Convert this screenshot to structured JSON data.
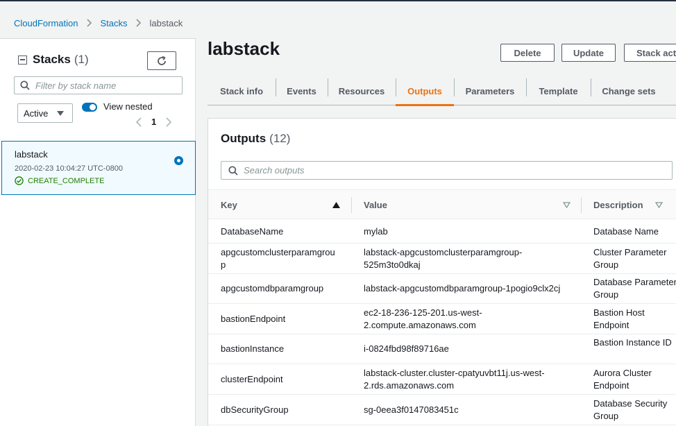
{
  "breadcrumb": {
    "items": [
      "CloudFormation",
      "Stacks"
    ],
    "current": "labstack"
  },
  "sidebar": {
    "title": "Stacks",
    "count": "(1)",
    "filter_placeholder": "Filter by stack name",
    "status_filter": "Active",
    "view_nested_label": "View nested",
    "view_nested_enabled": true,
    "page": "1",
    "stacks": [
      {
        "name": "labstack",
        "date": "2020-02-23 10:04:27 UTC-0800",
        "status": "CREATE_COMPLETE",
        "selected": true
      }
    ]
  },
  "main": {
    "title": "labstack",
    "buttons": {
      "delete": "Delete",
      "update": "Update",
      "stack_actions": "Stack actions"
    },
    "tabs": [
      {
        "label": "Stack info"
      },
      {
        "label": "Events"
      },
      {
        "label": "Resources"
      },
      {
        "label": "Outputs",
        "active": true
      },
      {
        "label": "Parameters"
      },
      {
        "label": "Template"
      },
      {
        "label": "Change sets"
      }
    ]
  },
  "outputs": {
    "title": "Outputs",
    "count": "(12)",
    "search_placeholder": "Search outputs",
    "columns": {
      "key": "Key",
      "value": "Value",
      "description": "Description"
    },
    "rows": [
      {
        "key": "DatabaseName",
        "value": "mylab",
        "description": "Database Name"
      },
      {
        "key": "apgcustomclusterparamgrou p",
        "value": "labstack-apgcustomclusterparamgroup- 525m3to0dkaj",
        "description": "Cluster Parameter Group"
      },
      {
        "key": "apgcustomdbparamgroup",
        "value": "labstack-apgcustomdbparamgroup-1pogio9clx2cj",
        "description": "Database Parameter Group"
      },
      {
        "key": "bastionEndpoint",
        "value": "ec2-18-236-125-201.us-west- 2.compute.amazonaws.com",
        "description": "Bastion Host Endpoint"
      },
      {
        "key": "bastionInstance",
        "value": "i-0824fbd98f89716ae",
        "description": "Bastion Instance ID"
      },
      {
        "key": "clusterEndpoint",
        "value": "labstack-cluster.cluster-cpatyuvbt11j.us-west- 2.rds.amazonaws.com",
        "description": "Aurora Cluster Endpoint"
      },
      {
        "key": "dbSecurityGroup",
        "value": "sg-0eea3f0147083451c",
        "description": "Database Security Group"
      }
    ]
  },
  "colors": {
    "link": "#0073bb",
    "accent": "#ec7211",
    "success": "#1d8102",
    "header": "#232f3e"
  },
  "icons": {
    "breadcrumb_separator": "chevron-right-icon",
    "collapse": "collapse-icon",
    "refresh": "refresh-icon",
    "search": "search-icon",
    "status_ok": "check-circle-icon",
    "sort_asc": "sort-ascending-icon",
    "sort_none": "sort-descending-icon"
  }
}
